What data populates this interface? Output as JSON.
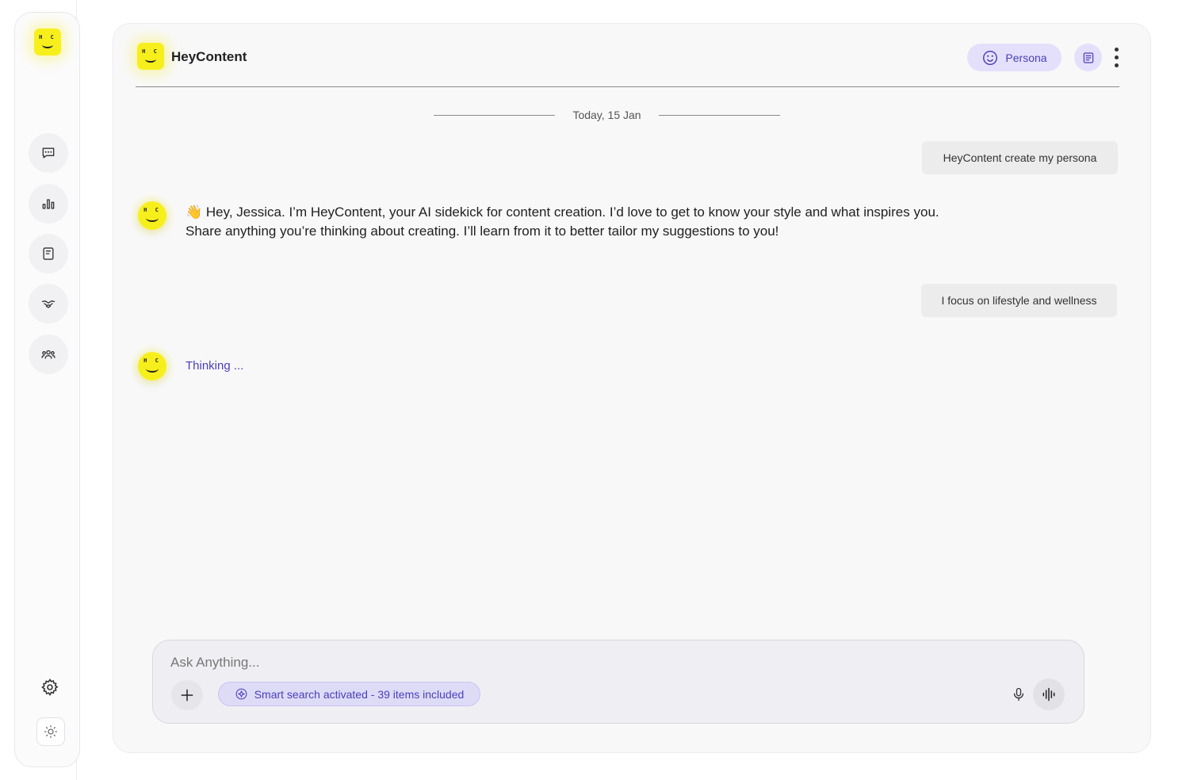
{
  "app": {
    "name": "HeyContent",
    "logo_letters": "H C",
    "accent_color": "#4a3fb8",
    "brand_yellow": "#f7ef1c"
  },
  "sidebar": {
    "items": [
      {
        "icon": "chat-icon",
        "name": "sidebar-item-chat"
      },
      {
        "icon": "analytics-icon",
        "name": "sidebar-item-analytics"
      },
      {
        "icon": "notebook-icon",
        "name": "sidebar-item-notes"
      },
      {
        "icon": "handshake-icon",
        "name": "sidebar-item-partnerships"
      },
      {
        "icon": "community-icon",
        "name": "sidebar-item-community"
      }
    ],
    "bottom": [
      {
        "icon": "gear-icon",
        "name": "settings-button"
      },
      {
        "icon": "sun-icon",
        "name": "theme-toggle"
      }
    ]
  },
  "header": {
    "title": "HeyContent",
    "persona_label": "Persona"
  },
  "chat": {
    "date_separator": "Today, 15 Jan",
    "messages": [
      {
        "role": "user",
        "text": "HeyContent create my persona"
      },
      {
        "role": "assistant",
        "line1": "👋 Hey, Jessica. I’m HeyContent, your AI sidekick for content creation. I’d love to get to know your style and what inspires you.",
        "line2": "Share anything you’re thinking about creating. I’ll learn from it to better tailor my suggestions to you!"
      },
      {
        "role": "user",
        "text": "I focus on lifestyle and wellness"
      },
      {
        "role": "assistant",
        "status": "Thinking ..."
      }
    ]
  },
  "composer": {
    "placeholder": "Ask Anything...",
    "value": "",
    "smart_search_label": "Smart search activated - 39 items included"
  }
}
